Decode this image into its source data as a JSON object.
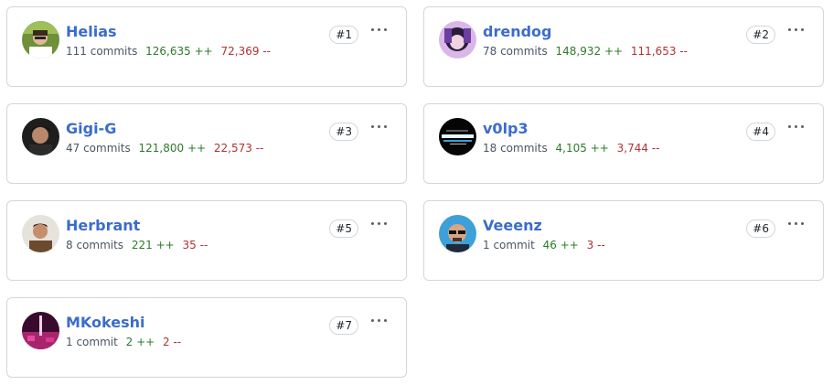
{
  "contributors": [
    {
      "name": "Helias",
      "commits": "111 commits",
      "additions": "126,635 ++",
      "deletions": "72,369 --",
      "rank": "#1"
    },
    {
      "name": "drendog",
      "commits": "78 commits",
      "additions": "148,932 ++",
      "deletions": "111,653 --",
      "rank": "#2"
    },
    {
      "name": "Gigi-G",
      "commits": "47 commits",
      "additions": "121,800 ++",
      "deletions": "22,573 --",
      "rank": "#3"
    },
    {
      "name": "v0lp3",
      "commits": "18 commits",
      "additions": "4,105 ++",
      "deletions": "3,744 --",
      "rank": "#4"
    },
    {
      "name": "Herbrant",
      "commits": "8 commits",
      "additions": "221 ++",
      "deletions": "35 --",
      "rank": "#5"
    },
    {
      "name": "Veeenz",
      "commits": "1 commit",
      "additions": "46 ++",
      "deletions": "3 --",
      "rank": "#6"
    },
    {
      "name": "MKokeshi",
      "commits": "1 commit",
      "additions": "2 ++",
      "deletions": "2 --",
      "rank": "#7"
    }
  ],
  "colors": {
    "name_link": "#3b6dc9",
    "additions": "#2c7a2c",
    "deletions": "#b13232",
    "border": "#d0d7de"
  },
  "icons": {
    "menu": "kebab-horizontal-icon"
  }
}
